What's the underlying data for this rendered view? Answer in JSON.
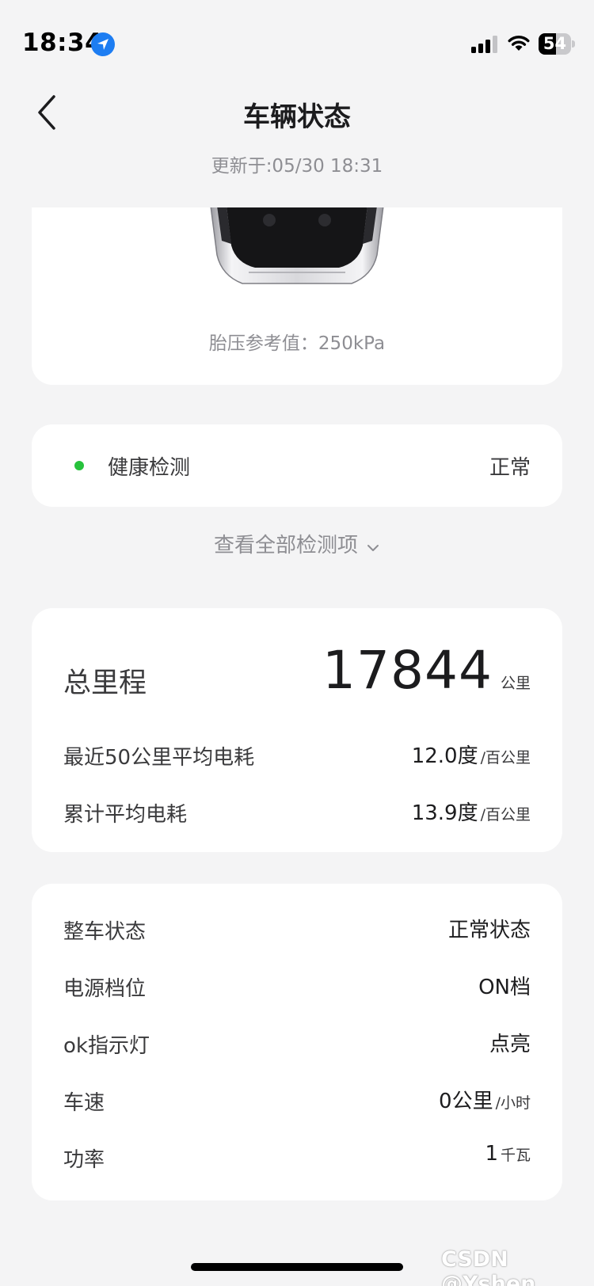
{
  "status_bar": {
    "time": "18:34",
    "battery": "54",
    "battery_level": 0.54
  },
  "nav": {
    "title": "车辆状态",
    "update_time": "更新于:05/30 18:31",
    "back_icon": "chevron-left-icon"
  },
  "car_card": {
    "tire_pressure": "胎压参考值：250kPa"
  },
  "health": {
    "label": "健康检测",
    "value": "正常",
    "status_color": "#27c23c",
    "view_all": "查看全部检测项"
  },
  "mileage": {
    "odometer_label": "总里程",
    "odometer_value": "17844",
    "odometer_unit": "公里",
    "rows": [
      {
        "label": "最近50公里平均电耗",
        "value": "12.0度",
        "unit": "/百公里"
      },
      {
        "label": "累计平均电耗",
        "value": "13.9度",
        "unit": "/百公里"
      }
    ]
  },
  "vehicle_state": {
    "rows": [
      {
        "label": "整车状态",
        "value": "正常状态",
        "unit": ""
      },
      {
        "label": "电源档位",
        "value": "ON档",
        "unit": ""
      },
      {
        "label": "ok指示灯",
        "value": "点亮",
        "unit": ""
      },
      {
        "label": "车速",
        "value": "0公里",
        "unit": "/小时"
      },
      {
        "label": "功率",
        "value": "1",
        "unit": "千瓦"
      }
    ]
  },
  "watermark": "CSDN @Yshen"
}
